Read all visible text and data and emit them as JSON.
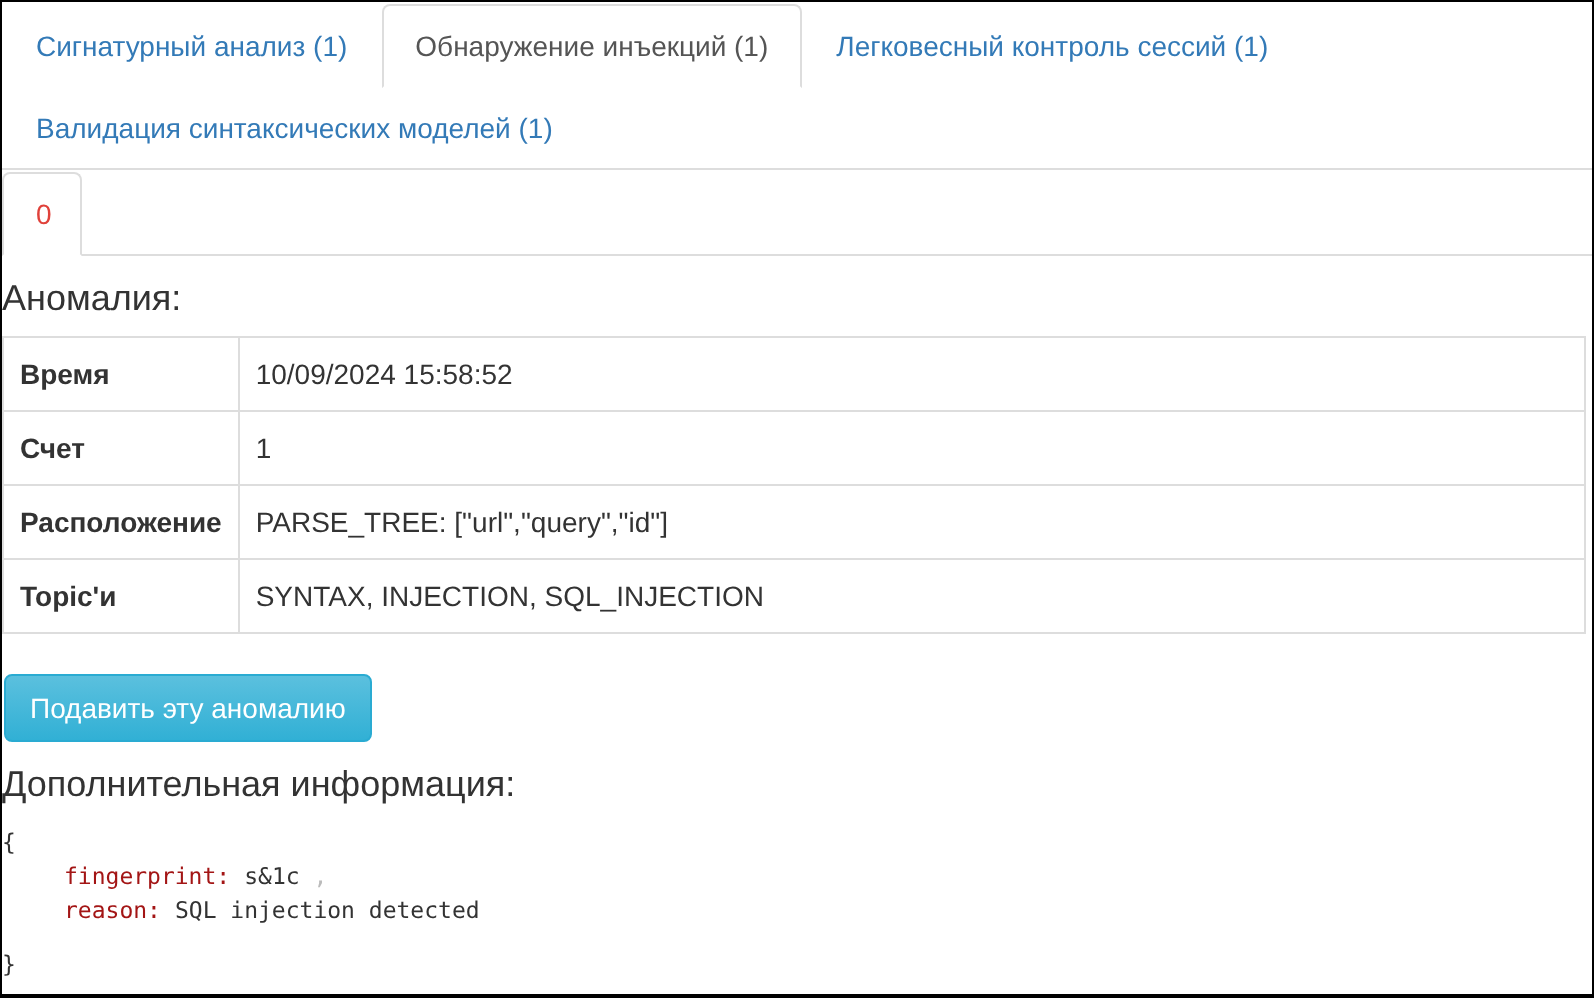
{
  "tabs": [
    {
      "label": "Сигнатурный анализ (1)",
      "selected": false
    },
    {
      "label": "Обнаружение инъекций (1)",
      "selected": true
    },
    {
      "label": "Легковесный контроль сессий (1)",
      "selected": false
    },
    {
      "label": "Валидация синтаксических моделей (1)",
      "selected": false
    }
  ],
  "subtabs": [
    {
      "label": "0",
      "selected": true
    }
  ],
  "anomaly_heading": "Аномалия:",
  "table": {
    "rows": [
      {
        "label": "Время",
        "value": "10/09/2024 15:58:52"
      },
      {
        "label": "Счет",
        "value": "1"
      },
      {
        "label": "Расположение",
        "value": "PARSE_TREE: [\"url\",\"query\",\"id\"]"
      },
      {
        "label": "Topic'и",
        "value": "SYNTAX, INJECTION, SQL_INJECTION"
      }
    ]
  },
  "suppress_button": "Подавить эту аномалию",
  "extra_heading": "Дополнительная информация:",
  "extra_info": {
    "open": "{",
    "entries": [
      {
        "key": "fingerprint:",
        "value": "s&1c",
        "separator": ","
      },
      {
        "key": "reason:",
        "value": "SQL injection detected"
      }
    ],
    "close": "}"
  }
}
